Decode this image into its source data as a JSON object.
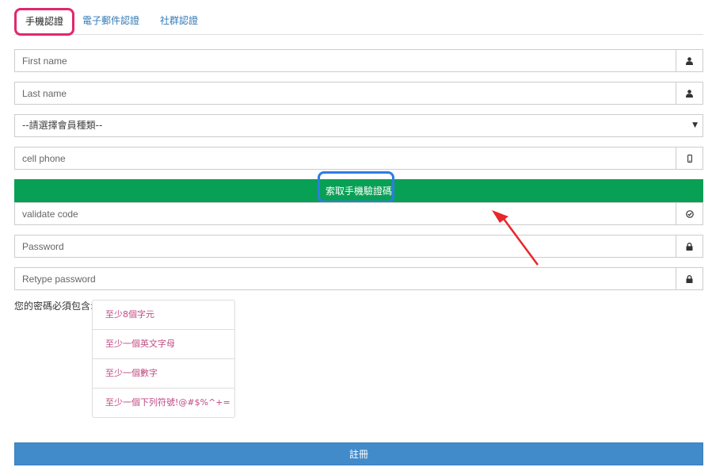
{
  "tabs": [
    {
      "label": "手機認證",
      "active": true
    },
    {
      "label": "電子郵件認證",
      "active": false
    },
    {
      "label": "社群認證",
      "active": false
    }
  ],
  "form": {
    "first_name": {
      "placeholder": "First name",
      "icon": "user-icon"
    },
    "last_name": {
      "placeholder": "Last name",
      "icon": "user-icon"
    },
    "member_type": {
      "selected": "--請選擇會員種類--"
    },
    "cell_phone": {
      "placeholder": "cell phone",
      "icon": "mobile-icon"
    },
    "sms_button_label": "索取手機驗證碼",
    "validate_code": {
      "placeholder": "validate code",
      "icon": "check-circle-icon"
    },
    "password": {
      "placeholder": "Password",
      "icon": "lock-icon"
    },
    "retype_password": {
      "placeholder": "Retype password",
      "icon": "lock-icon"
    }
  },
  "password_rules": {
    "intro": "您的密碼必須包含:",
    "items": [
      "至少8個字元",
      "至少一個英文字母",
      "至少一個數字",
      "至少一個下列符號!@#$%^+="
    ]
  },
  "register_label": "註冊",
  "colors": {
    "sms_button": "#08a055",
    "register_button": "#428bca",
    "active_tab_highlight": "#e0286e",
    "button_highlight": "#2d7de4",
    "annotation_arrow": "#e8262b",
    "rule_text": "#c04a83"
  }
}
